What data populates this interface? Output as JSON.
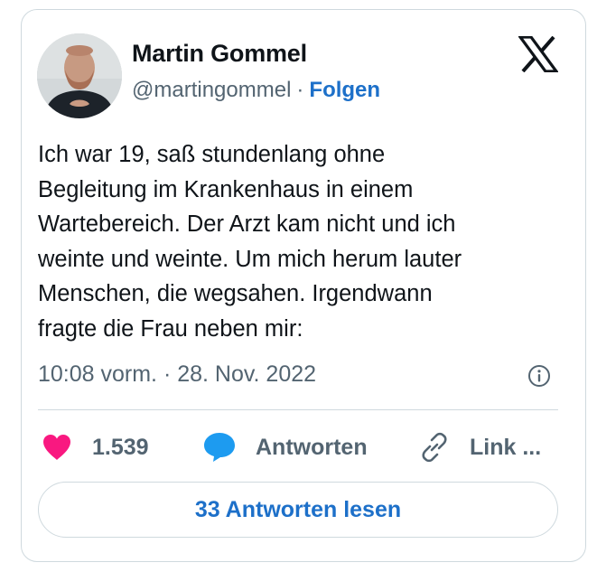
{
  "author": {
    "name": "Martin Gommel",
    "handle": "@martingommel",
    "separator": "·",
    "follow_label": "Folgen"
  },
  "tweet": {
    "lines": [
      "Ich war 19, saß stundenlang ohne",
      "Begleitung im Krankenhaus in einem",
      "Wartebereich. Der Arzt kam nicht und ich",
      "weinte und weinte. Um mich herum lauter",
      "Menschen, die wegsahen. Irgendwann",
      "fragte die Frau neben mir:"
    ],
    "timestamp": "10:08 vorm. · 28. Nov. 2022"
  },
  "actions": {
    "like_count": "1.539",
    "reply_label": "Antworten",
    "link_label": "Link ..."
  },
  "read_replies_label": "33 Antworten lesen",
  "colors": {
    "heart": "#f91880",
    "reply_bubble": "#1d9bf0",
    "accent_link": "#1d70c9",
    "secondary_text": "#536471",
    "border": "#cfd9de"
  },
  "icons": [
    "x-logo-icon",
    "info-icon",
    "heart-icon",
    "reply-bubble-icon",
    "link-icon"
  ]
}
